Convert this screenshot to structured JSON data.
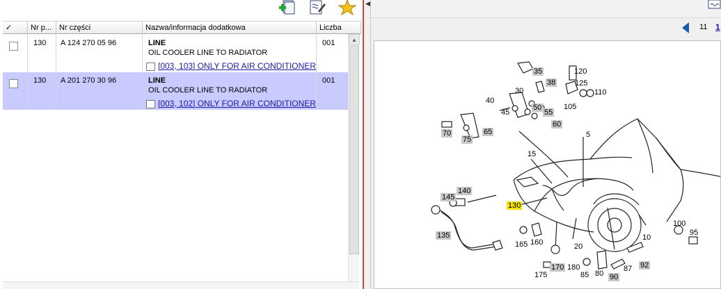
{
  "table": {
    "columns": [
      "✓",
      "Nr p...",
      "Nr części",
      "Nazwa/informacja dodatkowa",
      "Liczba"
    ],
    "rows": [
      {
        "pos": "130",
        "part_no": "A 124 270 05 96",
        "name": "LINE",
        "description": "OIL COOLER LINE TO RADIATOR",
        "note": "[003, 103] ONLY FOR AIR CONDITIONER",
        "qty": "001",
        "selected": false
      },
      {
        "pos": "130",
        "part_no": "A 201 270 30 96",
        "name": "LINE",
        "description": "OIL COOLER LINE TO RADIATOR",
        "note": "[003, 102] ONLY FOR AIR CONDITIONER",
        "qty": "001",
        "selected": true
      }
    ]
  },
  "pager": {
    "count": "11",
    "link": "1"
  },
  "diagram": {
    "callouts": [
      "35",
      "38",
      "120",
      "125",
      "110",
      "105",
      "30",
      "40",
      "45",
      "50",
      "55",
      "60",
      "70",
      "75",
      "65",
      "5",
      "15",
      "145",
      "140",
      "130",
      "135",
      "165",
      "160",
      "20",
      "10",
      "100",
      "95",
      "170",
      "180",
      "175",
      "85",
      "80",
      "90",
      "87",
      "92"
    ]
  },
  "colors": {
    "selected_row": "#c9cbff",
    "link": "#1a1aa8",
    "highlight": "#f2e400",
    "splitter_accent": "#d94040"
  },
  "icons": [
    "add-part-icon",
    "edit-note-icon",
    "favorite-star-icon",
    "image-toolbar-icon",
    "previous-page-icon"
  ]
}
